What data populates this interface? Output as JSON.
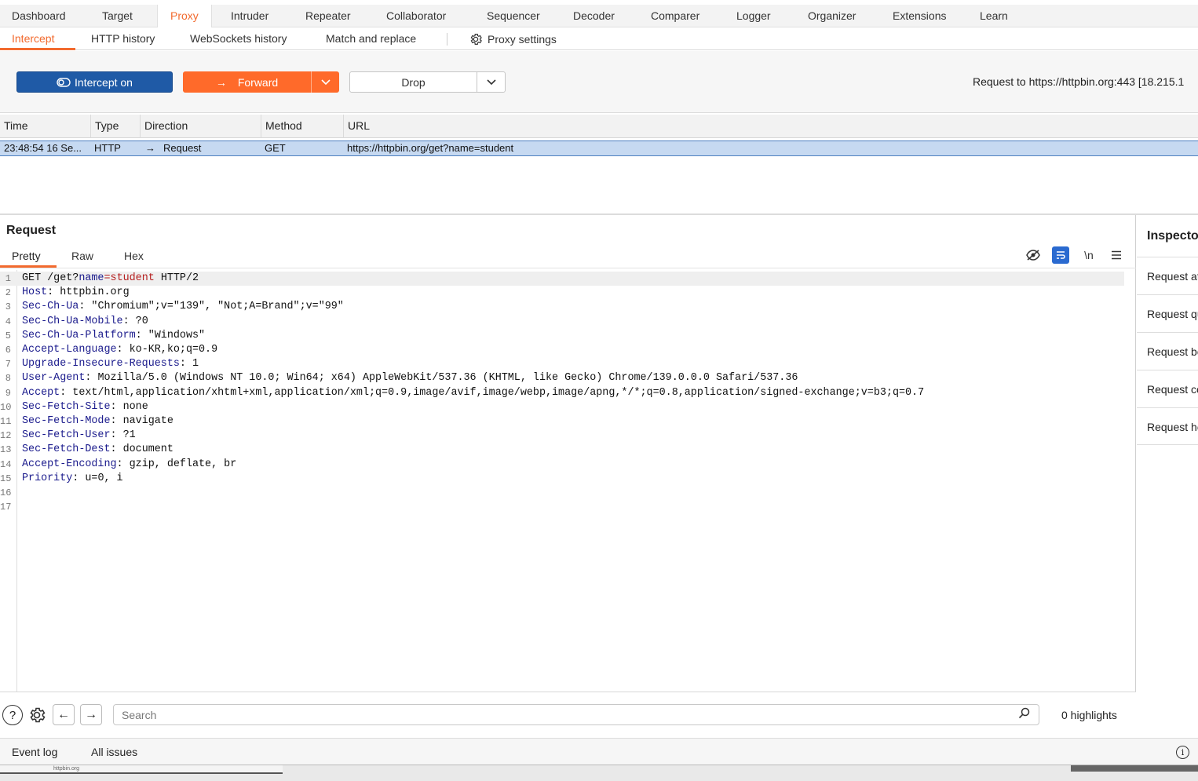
{
  "top_tabs": [
    "Dashboard",
    "Target",
    "Proxy",
    "Intruder",
    "Repeater",
    "Collaborator",
    "Sequencer",
    "Decoder",
    "Comparer",
    "Logger",
    "Organizer",
    "Extensions",
    "Learn"
  ],
  "sub_tabs": {
    "intercept": "Intercept",
    "http_history": "HTTP history",
    "websockets_history": "WebSockets history",
    "match_replace": "Match and replace",
    "proxy_settings": "Proxy settings"
  },
  "toolbar": {
    "intercept_label": "Intercept on",
    "forward_label": "Forward",
    "drop_label": "Drop",
    "request_info": "Request to https://httpbin.org:443  [18.215.1"
  },
  "table": {
    "headers": [
      "Time",
      "Type",
      "Direction",
      "Method",
      "URL"
    ],
    "row": {
      "time": "23:48:54 16 Se...",
      "type": "HTTP",
      "direction": "Request",
      "method": "GET",
      "url": "https://httpbin.org/get?name=student"
    }
  },
  "request": {
    "title": "Request",
    "views": [
      "Pretty",
      "Raw",
      "Hex"
    ],
    "line_numbers": [
      "1",
      "2",
      "3",
      "4",
      "5",
      "6",
      "7",
      "8",
      "9",
      "10",
      "11",
      "12",
      "13",
      "14",
      "15",
      "16",
      "17"
    ],
    "request_line": {
      "method": "GET /get?",
      "param_name": "name",
      "eq": "=",
      "param_value": "student",
      "protocol": " HTTP/2"
    },
    "headers": [
      {
        "k": "Host",
        "v": " httpbin.org"
      },
      {
        "k": "Sec-Ch-Ua",
        "v": " \"Chromium\";v=\"139\", \"Not;A=Brand\";v=\"99\""
      },
      {
        "k": "Sec-Ch-Ua-Mobile",
        "v": " ?0"
      },
      {
        "k": "Sec-Ch-Ua-Platform",
        "v": " \"Windows\""
      },
      {
        "k": "Accept-Language",
        "v": " ko-KR,ko;q=0.9"
      },
      {
        "k": "Upgrade-Insecure-Requests",
        "v": " 1"
      },
      {
        "k": "User-Agent",
        "v": " Mozilla/5.0 (Windows NT 10.0; Win64; x64) AppleWebKit/537.36 (KHTML, like Gecko) Chrome/139.0.0.0 Safari/537.36"
      },
      {
        "k": "Accept",
        "v": " text/html,application/xhtml+xml,application/xml;q=0.9,image/avif,image/webp,image/apng,*/*;q=0.8,application/signed-exchange;v=b3;q=0.7"
      },
      {
        "k": "Sec-Fetch-Site",
        "v": " none"
      },
      {
        "k": "Sec-Fetch-Mode",
        "v": " navigate"
      },
      {
        "k": "Sec-Fetch-User",
        "v": " ?1"
      },
      {
        "k": "Sec-Fetch-Dest",
        "v": " document"
      },
      {
        "k": "Accept-Encoding",
        "v": " gzip, deflate, br"
      },
      {
        "k": "Priority",
        "v": " u=0, i"
      }
    ],
    "newline_toggle": "\\n",
    "search_placeholder": "Search",
    "highlights": "0 highlights"
  },
  "inspector": {
    "title": "Inspector",
    "items": [
      "Request attributes",
      "Request query parameters",
      "Request body parameters",
      "Request cookies",
      "Request headers"
    ]
  },
  "footer": {
    "event_log": "Event log",
    "all_issues": "All issues"
  },
  "taskbar": {
    "thumb_label": "httpbin.org"
  },
  "icons": {
    "intercept": "eye-toggle-icon",
    "forward": "arrow-right-icon",
    "settings": "gear-icon",
    "help": "help-icon",
    "search": "search-icon",
    "info": "info-icon"
  },
  "colors": {
    "accent": "#f26a2e",
    "intercept_btn": "#1f5aa6",
    "forward_btn": "#ff6a2a",
    "selected_row": "#c6d9f1"
  }
}
